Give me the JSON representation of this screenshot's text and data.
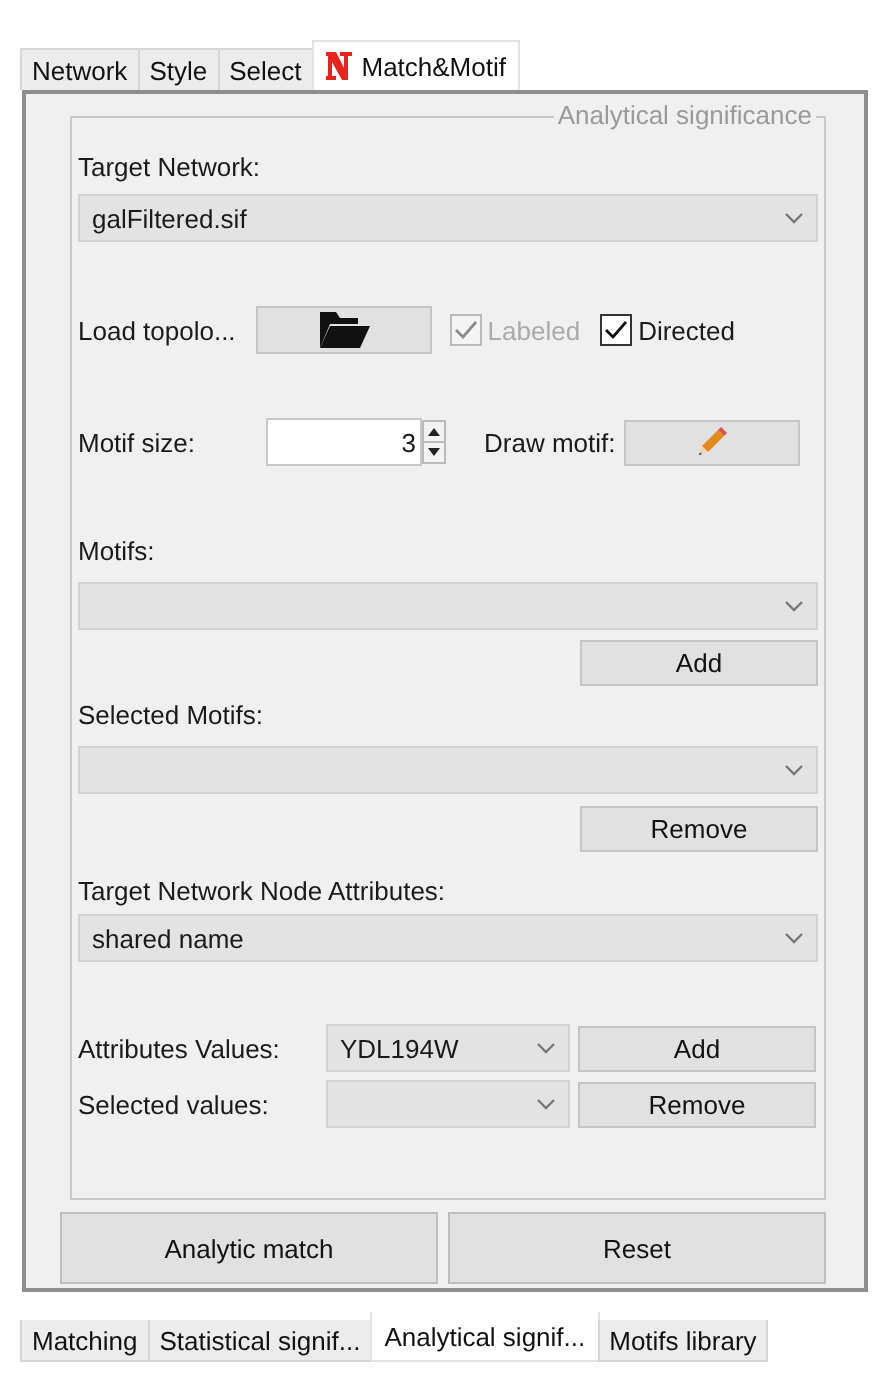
{
  "top_tabs": [
    {
      "label": "Network",
      "selected": false,
      "kind": "plain"
    },
    {
      "label": "Style",
      "selected": false,
      "kind": "plain"
    },
    {
      "label": "Select",
      "selected": false,
      "kind": "plain"
    },
    {
      "label": "Match&Motif",
      "selected": true,
      "kind": "plugin"
    }
  ],
  "group_title": "Analytical significance",
  "target_network": {
    "label": "Target Network:",
    "value": "galFiltered.sif"
  },
  "load_topology": {
    "label": "Load topolo..."
  },
  "labeled": {
    "label": "Labeled",
    "checked": true,
    "disabled": true
  },
  "directed": {
    "label": "Directed",
    "checked": true,
    "disabled": false
  },
  "motif_size": {
    "label": "Motif size:",
    "value": "3"
  },
  "draw_motif": {
    "label": "Draw motif:"
  },
  "motifs": {
    "label": "Motifs:",
    "button": "Add"
  },
  "selected_motifs": {
    "label": "Selected Motifs:",
    "button": "Remove"
  },
  "node_attributes": {
    "label": "Target Network Node Attributes:",
    "value": "shared name"
  },
  "attribute_values": {
    "label": "Attributes Values:",
    "value": "YDL194W",
    "button": "Add"
  },
  "selected_values": {
    "label": "Selected values:",
    "button": "Remove"
  },
  "actions": [
    "Analytic match",
    "Reset"
  ],
  "bottom_tabs": [
    {
      "label": "Matching",
      "selected": false
    },
    {
      "label": "Statistical signif...",
      "selected": false
    },
    {
      "label": "Analytical signif...",
      "selected": true
    },
    {
      "label": "Motifs library",
      "selected": false
    }
  ]
}
